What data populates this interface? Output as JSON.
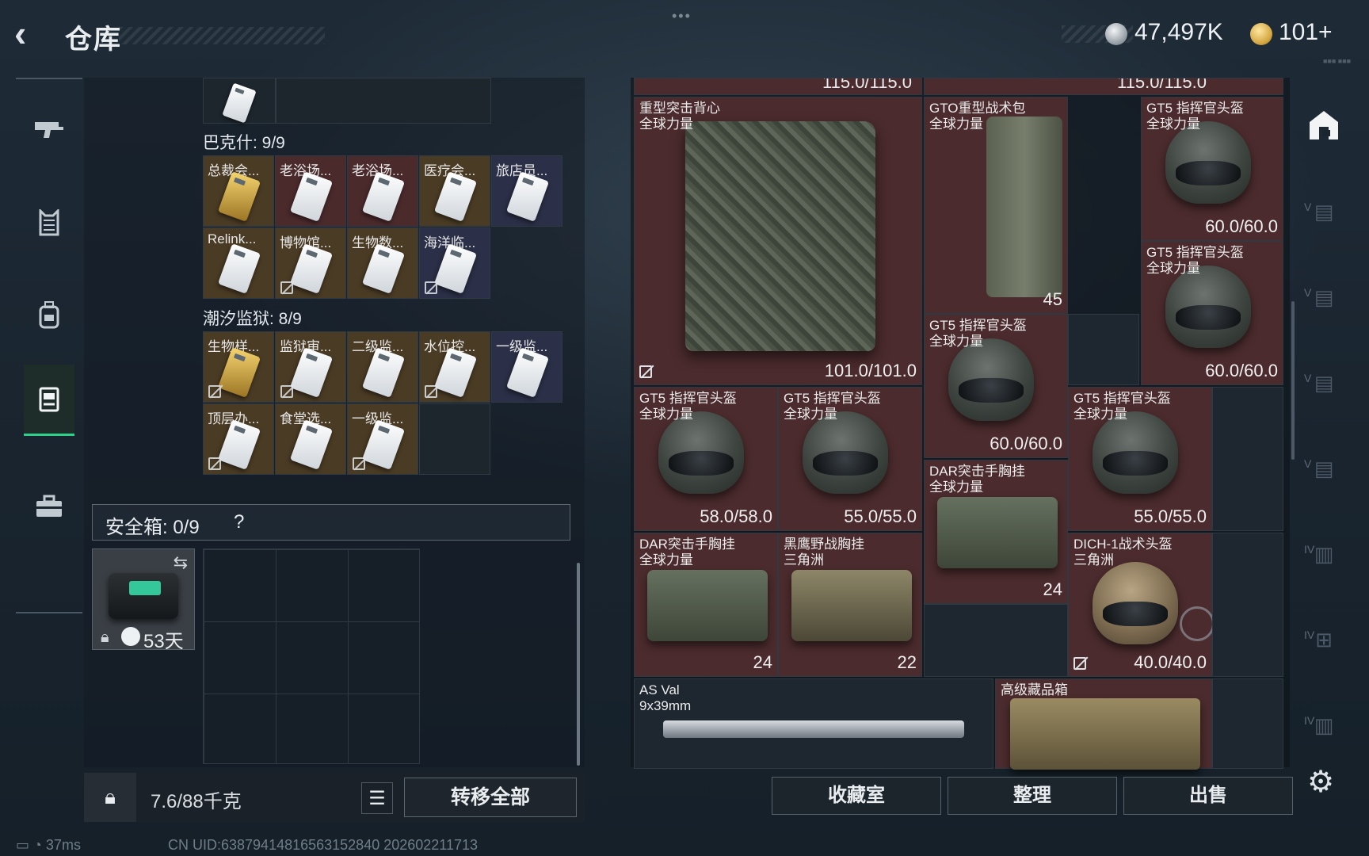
{
  "header": {
    "title": "仓库",
    "grip": "•••",
    "currency_silver": "47,497K",
    "currency_gold": "101+",
    "small_text": "■■■ ■■■"
  },
  "left_nav": {
    "items": [
      {
        "icon": "gun-icon"
      },
      {
        "icon": "vest-icon"
      },
      {
        "icon": "backpack-icon"
      },
      {
        "icon": "container-icon"
      },
      {
        "icon": "briefcase-icon"
      }
    ]
  },
  "backpack": {
    "section_bakshi": {
      "title": "巴克什: 9/9"
    },
    "bakshi_items": [
      "总裁会...",
      "老浴场...",
      "老浴场...",
      "医疗会...",
      "旅店员...",
      "Relink...",
      "博物馆...",
      "生物数...",
      "海洋临..."
    ],
    "section_tide": {
      "title": "潮汐监狱: 8/9"
    },
    "tide_items": [
      "生物样...",
      "监狱审...",
      "二级监...",
      "水位控...",
      "一级监...",
      "顶层办...",
      "食堂选...",
      "一级监..."
    ]
  },
  "safe_box": {
    "label": "安全箱: 0/9",
    "help": "?",
    "days": "53天"
  },
  "footer_left": {
    "weight": "7.6/88千克",
    "transfer_all": "转移全部"
  },
  "status_bar": {
    "ping": "37ms",
    "uid": "CN UID:6387941481656315284​0 2026​02211713"
  },
  "stash": {
    "top_partial_left": "115.0/115.0",
    "top_partial_right": "115.0/115.0",
    "items": {
      "vest": {
        "name": "重型突击背心\n全球力量",
        "durability": "101.0/101.0"
      },
      "gto_pack": {
        "name": "GTO重型战术包\n全球力量",
        "count": "45"
      },
      "gt5_1": {
        "name": "GT5 指挥官头盔\n全球力量",
        "durability": "60.0/60.0"
      },
      "gt5_2": {
        "name": "GT5 指挥官头盔\n全球力量",
        "durability": "60.0/60.0"
      },
      "gt5_3": {
        "name": "GT5 指挥官头盔\n全球力量",
        "durability": "60.0/60.0"
      },
      "gt5_4": {
        "name": "GT5 指挥官头盔\n全球力量",
        "durability": "58.0/58.0"
      },
      "gt5_5": {
        "name": "GT5 指挥官头盔\n全球力量",
        "durability": "55.0/55.0"
      },
      "gt5_6": {
        "name": "GT5 指挥官头盔\n全球力量",
        "durability": "55.0/55.0"
      },
      "dar_1": {
        "name": "DAR突击手胸挂\n全球力量",
        "count": "24"
      },
      "dar_2": {
        "name": "DAR突击手胸挂\n全球力量",
        "count": "24"
      },
      "blackhawk": {
        "name": "黑鹰野战胸挂\n三角洲",
        "count": "22"
      },
      "dich": {
        "name": "DICH-1战术头盔\n三角洲",
        "durability": "40.0/40.0"
      },
      "asval": {
        "name": "AS Val\n9x39mm"
      },
      "crate": {
        "name": "高级藏品箱"
      }
    }
  },
  "actions": {
    "collection": "收藏室",
    "sort": "整理",
    "sell": "出售"
  },
  "side_nav": {
    "items": [
      {
        "icon": "home-stash-icon",
        "rank": ""
      },
      {
        "icon": "stash-tab-icon",
        "rank": "V"
      },
      {
        "icon": "stash-tab-icon",
        "rank": "V"
      },
      {
        "icon": "stash-tab-icon",
        "rank": "V"
      },
      {
        "icon": "stash-tab-icon",
        "rank": "V"
      },
      {
        "icon": "folder-tab-icon",
        "rank": "IV"
      },
      {
        "icon": "folder-add-icon",
        "rank": "IV"
      },
      {
        "icon": "folder-tab-icon",
        "rank": "IV"
      }
    ]
  },
  "colors": {
    "accent": "#2fd089",
    "item_red": "#4b2b2d",
    "item_gold": "#4a3b24",
    "item_blue": "#2b2f47"
  }
}
